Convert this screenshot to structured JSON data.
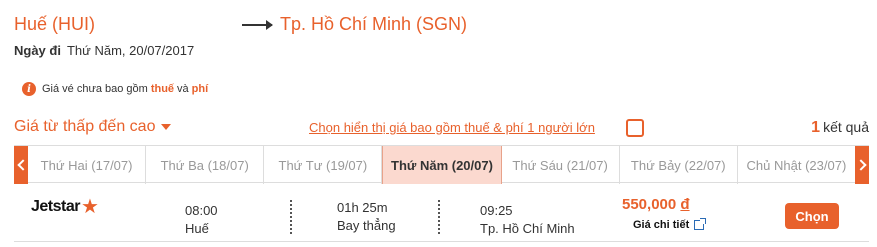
{
  "route": {
    "from": "Huế (HUI)",
    "to": "Tp. Hồ Chí Minh (SGN)"
  },
  "date_line": {
    "label": "Ngày đi",
    "value": "Thứ Năm, 20/07/2017"
  },
  "notice": {
    "icon": "info-icon",
    "prefix": "Giá vé chưa bao gồm",
    "tax": "thuế",
    "and": "và",
    "fee": "phí"
  },
  "sort": {
    "label": "Giá từ thấp đến cao"
  },
  "options": {
    "show_price_incl": "Chọn hiển thị giá bao gồm thuế & phí 1 người lớn",
    "checked": false
  },
  "results": {
    "count": "1",
    "label": "kết quả"
  },
  "date_tabs": [
    {
      "label": "Thứ Hai (17/07)"
    },
    {
      "label": "Thứ Ba (18/07)"
    },
    {
      "label": "Thứ Tư (19/07)"
    },
    {
      "label": "Thứ Năm (20/07)",
      "active": true
    },
    {
      "label": "Thứ Sáu (21/07)"
    },
    {
      "label": "Thứ Bảy (22/07)"
    },
    {
      "label": "Chủ Nhật (23/07)"
    }
  ],
  "flight": {
    "airline": "Jetstar",
    "departure_time": "08:00",
    "departure_city": "Huế",
    "duration": "01h 25m",
    "stops": "Bay thẳng",
    "arrival_time": "09:25",
    "arrival_city": "Tp. Hồ Chí Minh",
    "price": "550,000",
    "currency": "đ",
    "detail_label": "Giá chi tiết",
    "select_label": "Chọn"
  },
  "colors": {
    "accent": "#e8612c",
    "active_tab_bg": "#fbd9cf"
  }
}
